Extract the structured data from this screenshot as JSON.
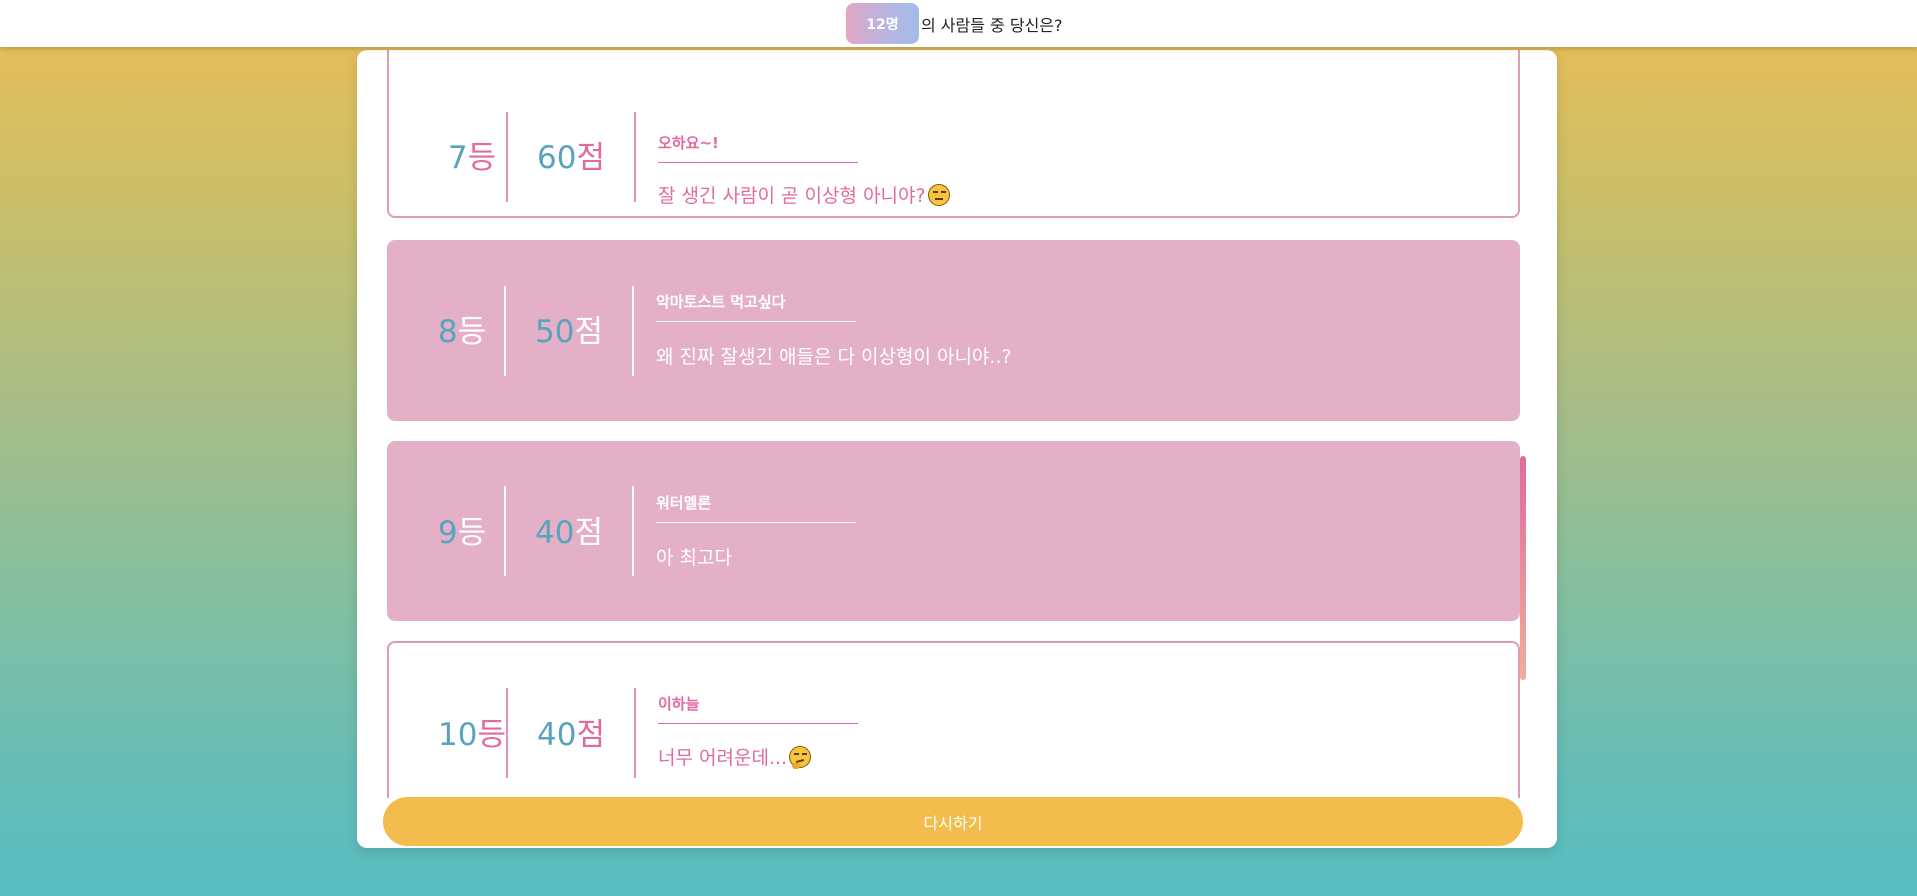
{
  "header": {
    "count_badge": "12명",
    "question": "의 사람들 중 당신은?"
  },
  "results": [
    {
      "rank": "7",
      "rank_unit": "등",
      "score": "60",
      "score_unit": "점",
      "name": "오하요~!",
      "comment": "잘 생긴 사람이 곧 이상형 아니야?",
      "emoji": "unamused-face-icon",
      "style": "light"
    },
    {
      "rank": "8",
      "rank_unit": "등",
      "score": "50",
      "score_unit": "점",
      "name": "악마토스트 먹고싶다",
      "comment": "왜 진짜 잘생긴 애들은 다 이상형이 아니야..?",
      "emoji": "",
      "style": "pink"
    },
    {
      "rank": "9",
      "rank_unit": "등",
      "score": "40",
      "score_unit": "점",
      "name": "워터멜론",
      "comment": "아 최고다",
      "emoji": "",
      "style": "pink"
    },
    {
      "rank": "10",
      "rank_unit": "등",
      "score": "40",
      "score_unit": "점",
      "name": "이하늘",
      "comment": "너무 어려운데...",
      "emoji": "thinking-face-icon",
      "style": "light"
    }
  ],
  "footer": {
    "retry_label": "다시하기"
  },
  "colors": {
    "accent_pink": "#e26aa0",
    "number_blue": "#5aa3bd",
    "card_pink": "#e3b0c8",
    "button_yellow": "#f3bd4e"
  }
}
